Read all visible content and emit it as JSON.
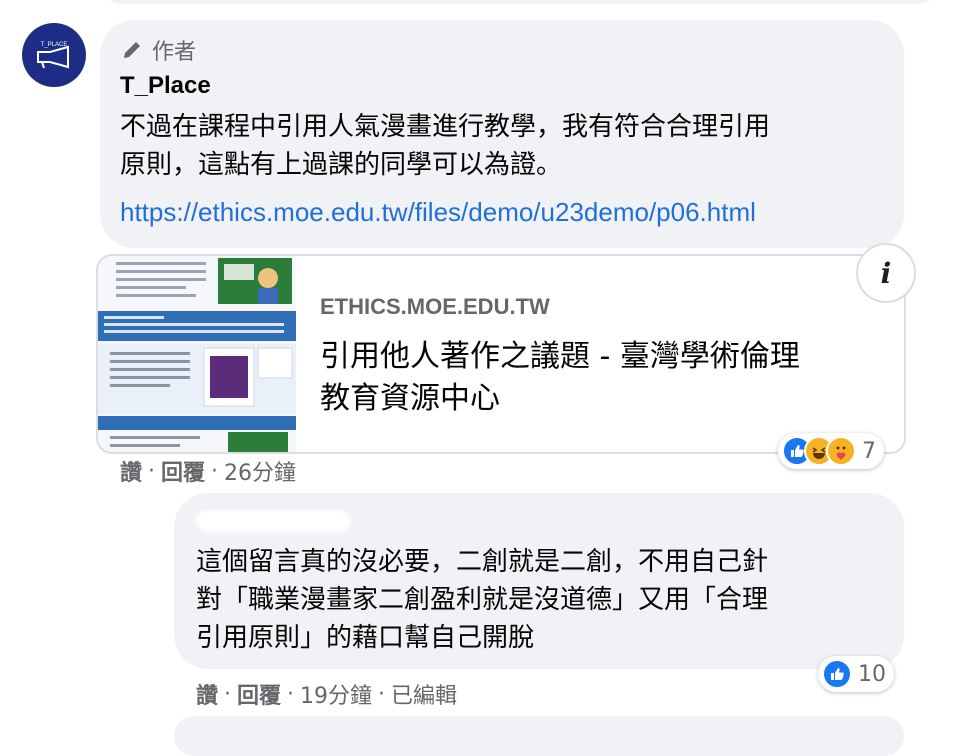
{
  "comment1": {
    "badge_label": "作者",
    "author_name": "T_Place",
    "avatar_text": "T_PLACE",
    "body": "不過在課程中引用人氣漫畫進行教學，我有符合合理引用\n原則，這點有上過課的同學可以為證。",
    "link": "https://ethics.moe.edu.tw/files/demo/u23demo/p06.html",
    "preview": {
      "domain": "ETHICS.MOE.EDU.TW",
      "title": "引用他人著作之議題 - 臺灣學術倫理\n教育資源中心",
      "info_label": "i"
    },
    "reactions": {
      "icons": [
        "like-icon",
        "haha-icon",
        "care-icon"
      ],
      "count": "7"
    },
    "meta": {
      "like": "讚",
      "reply": "回覆",
      "time": "26分鐘"
    }
  },
  "comment2": {
    "body": "這個留言真的沒必要，二創就是二創，不用自己針\n對「職業漫畫家二創盈利就是沒道德」又用「合理\n引用原則」的藉口幫自己開脫",
    "reactions": {
      "icons": [
        "like-icon"
      ],
      "count": "10"
    },
    "meta": {
      "like": "讚",
      "reply": "回覆",
      "time": "19分鐘",
      "edited": "已編輯"
    }
  },
  "colors": {
    "bubble": "#f0f2f5",
    "link": "#216fdb",
    "secondary_text": "#65676b",
    "like_blue": "#1877f2",
    "avatar_navy": "#1d2d85"
  }
}
